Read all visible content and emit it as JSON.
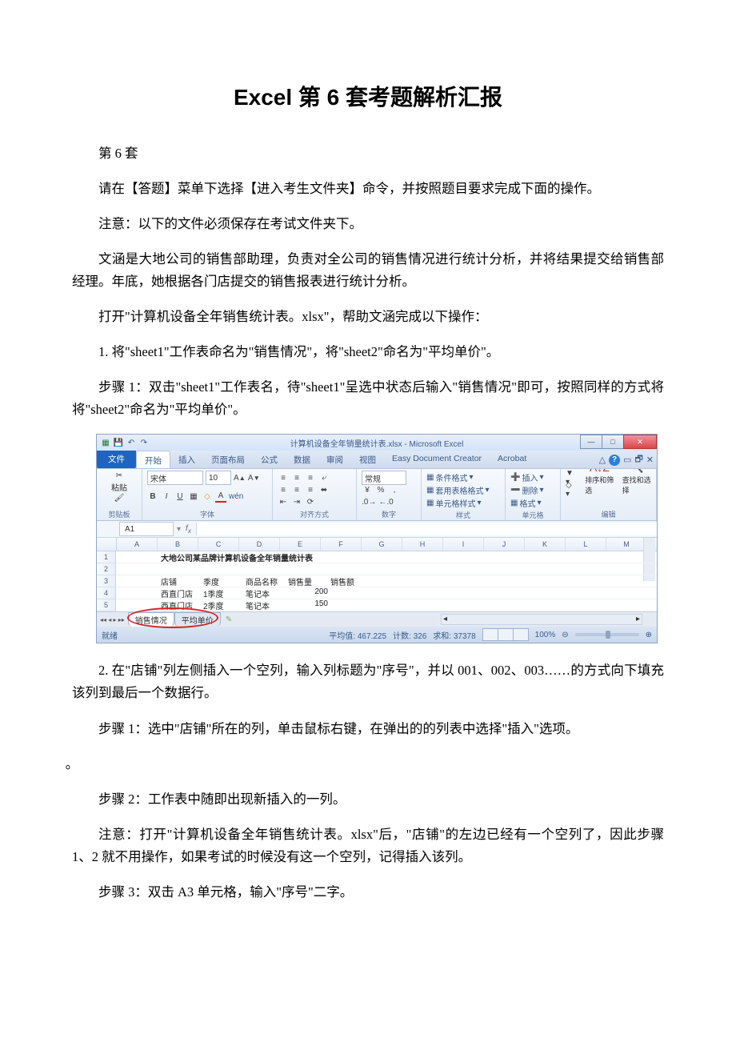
{
  "title": "Excel 第 6 套考题解析汇报",
  "paragraphs": {
    "p1": "第 6 套",
    "p2": "请在【答题】菜单下选择【进入考生文件夹】命令，并按照题目要求完成下面的操作。",
    "p3": "注意：以下的文件必须保存在考试文件夹下。",
    "p4": "文涵是大地公司的销售部助理，负责对全公司的销售情况进行统计分析，并将结果提交给销售部经理。年底，她根据各门店提交的销售报表进行统计分析。",
    "p5": "打开\"计算机设备全年销售统计表。xlsx\"，帮助文涵完成以下操作：",
    "p6": "1. 将\"sheet1\"工作表命名为\"销售情况\"，将\"sheet2\"命名为\"平均单价\"。",
    "p7": "步骤 1：双击\"sheet1\"工作表名，待\"sheet1\"呈选中状态后输入\"销售情况\"即可，按照同样的方式将将\"sheet2\"命名为\"平均单价\"。",
    "p8": "2. 在\"店铺\"列左侧插入一个空列，输入列标题为\"序号\"，并以 001、002、003……的方式向下填充该列到最后一个数据行。",
    "p9": "步骤 1：选中\"店铺\"所在的列，单击鼠标右键，在弹出的的列表中选择\"插入\"选项。",
    "p10": "步骤 2：工作表中随即出现新插入的一列。",
    "p11": "注意：打开\"计算机设备全年销售统计表。xlsx\"后，\"店铺\"的左边已经有一个空列了，因此步骤 1、2 就不用操作，如果考试的时候没有这一个空列，记得插入该列。",
    "p12": "步骤 3：双击 A3 单元格，输入\"序号\"二字。"
  },
  "excel": {
    "window_title": "计算机设备全年销量统计表.xlsx - Microsoft Excel",
    "tabs": {
      "file": "文件",
      "home": "开始",
      "insert": "插入",
      "layout": "页面布局",
      "formulas": "公式",
      "data": "数据",
      "review": "审阅",
      "view": "视图",
      "edc": "Easy Document Creator",
      "acrobat": "Acrobat"
    },
    "ribbon": {
      "clipboard": "剪贴板",
      "paste": "粘贴",
      "font_group": "字体",
      "font_name": "宋体",
      "font_size": "10",
      "align": "对齐方式",
      "number": "数字",
      "number_format": "常规",
      "styles": "样式",
      "cond_fmt": "条件格式",
      "table_fmt": "套用表格格式",
      "cell_fmt": "单元格样式",
      "cells": "单元格",
      "insert_btn": "插入",
      "delete_btn": "删除",
      "format_btn": "格式",
      "editing": "编辑",
      "sort_filter": "排序和筛选",
      "find_select": "查找和选择"
    },
    "namebox": "A1",
    "columns": [
      "A",
      "B",
      "C",
      "D",
      "E",
      "F",
      "G",
      "H",
      "I",
      "J",
      "K",
      "L",
      "M"
    ],
    "rows": [
      "1",
      "2",
      "3",
      "4",
      "5"
    ],
    "grid": {
      "r1_b": "大地公司某品牌计算机设备全年销量统计表",
      "r3": {
        "b": "店铺",
        "c": "季度",
        "d": "商品名称",
        "e": "销售量",
        "f": "销售额"
      },
      "r4": {
        "b": "西直门店",
        "c": "1季度",
        "d": "笔记本",
        "e": "200"
      },
      "r5": {
        "b": "西直门店",
        "c": "2季度",
        "d": "笔记本",
        "e": "150"
      }
    },
    "sheet_tabs": {
      "s1": "销售情况",
      "s2": "平均单价"
    },
    "status": {
      "ready": "就绪",
      "avg": "平均值: 467.225",
      "count": "计数: 326",
      "sum": "求和: 37378",
      "zoom": "100%"
    }
  }
}
